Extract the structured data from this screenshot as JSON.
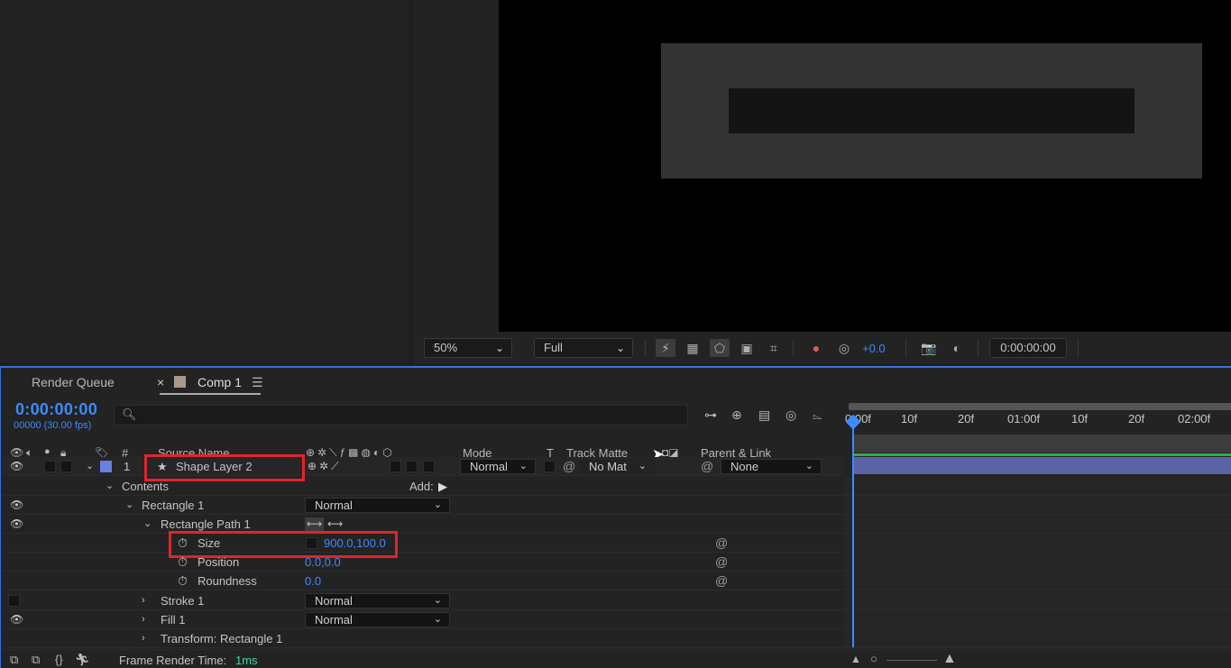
{
  "viewer_toolbar": {
    "zoom": "50%",
    "resolution": "Full",
    "exposure": "+0.0",
    "timecode": "0:00:00:00"
  },
  "timeline_panel": {
    "tabs": [
      {
        "label": "Render Queue"
      },
      {
        "label": "Comp 1"
      }
    ],
    "close_glyph": "×",
    "menu_glyph": "☰",
    "current_time": "0:00:00:00",
    "frame_info": "00000 (30.00 fps)",
    "search_placeholder": ""
  },
  "columns": {
    "number": "#",
    "source_name": "Source Name",
    "mode": "Mode",
    "t": "T",
    "track_matte": "Track Matte",
    "parent_link": "Parent & Link"
  },
  "layers": [
    {
      "index": "1",
      "name": "Shape Layer 2",
      "label_color": "#6a7fe0",
      "mode": "Normal",
      "track_matte": "No Mat",
      "parent": "None"
    }
  ],
  "properties": {
    "contents_label": "Contents",
    "add_label": "Add:",
    "rectangle_group": {
      "label": "Rectangle 1",
      "mode": "Normal"
    },
    "rectangle_path": {
      "label": "Rectangle Path 1"
    },
    "size": {
      "label": "Size",
      "value": "900.0,100.0"
    },
    "position": {
      "label": "Position",
      "value": "0.0,0.0"
    },
    "roundness": {
      "label": "Roundness",
      "value": "0.0"
    },
    "stroke": {
      "label": "Stroke 1",
      "mode": "Normal"
    },
    "fill": {
      "label": "Fill 1",
      "mode": "Normal"
    },
    "transform": {
      "label": "Transform: Rectangle 1"
    }
  },
  "ruler": {
    "ticks": [
      "0:00f",
      "10f",
      "20f",
      "01:00f",
      "10f",
      "20f",
      "02:00f"
    ]
  },
  "status_bar": {
    "label": "Frame Render Time:",
    "value": "1ms"
  },
  "colors": {
    "accent_blue": "#3b8cff",
    "highlight_red": "#e0242c",
    "layer_bar": "#5a62a6",
    "work_area_green": "#2fae4a"
  }
}
